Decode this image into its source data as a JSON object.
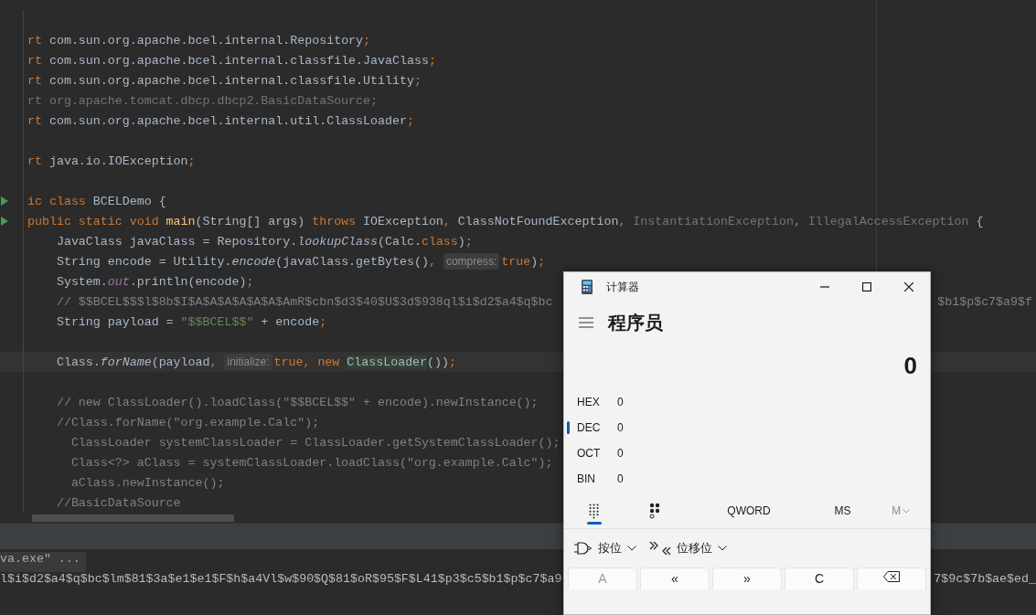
{
  "editor": {
    "lines": [
      {
        "kind": "line",
        "run": false
      },
      {
        "kind": "line",
        "run": false,
        "tokens": [
          {
            "kind": "keyword",
            "text": "rt"
          },
          {
            "kind": "plain",
            "text": " com.sun.org.apache.bcel.internal.Repository"
          },
          {
            "kind": "keyword",
            "text": ";"
          }
        ]
      },
      {
        "kind": "line",
        "run": false,
        "tokens": [
          {
            "kind": "keyword",
            "text": "rt"
          },
          {
            "kind": "plain",
            "text": " com.sun.org.apache.bcel.internal.classfile.JavaClass"
          },
          {
            "kind": "keyword",
            "text": ";"
          }
        ]
      },
      {
        "kind": "line",
        "run": false,
        "tokens": [
          {
            "kind": "keyword",
            "text": "rt"
          },
          {
            "kind": "plain",
            "text": " com.sun.org.apache.bcel.internal.classfile.Utility"
          },
          {
            "kind": "keyword",
            "text": ";"
          }
        ]
      },
      {
        "kind": "line",
        "run": false,
        "tokens": [
          {
            "kind": "unused",
            "text": "rt org.apache.tomcat.dbcp.dbcp2.BasicDataSource;"
          }
        ]
      },
      {
        "kind": "line",
        "run": false,
        "tokens": [
          {
            "kind": "keyword",
            "text": "rt"
          },
          {
            "kind": "plain",
            "text": " com.sun.org.apache.bcel.internal.util.ClassLoader"
          },
          {
            "kind": "keyword",
            "text": ";"
          }
        ]
      },
      {
        "kind": "line",
        "run": false
      },
      {
        "kind": "line",
        "run": false,
        "tokens": [
          {
            "kind": "keyword",
            "text": "rt"
          },
          {
            "kind": "plain",
            "text": " java.io.IOException"
          },
          {
            "kind": "keyword",
            "text": ";"
          }
        ]
      },
      {
        "kind": "line",
        "run": false
      },
      {
        "kind": "line",
        "run": true,
        "tokens": [
          {
            "kind": "keyword",
            "text": "ic class"
          },
          {
            "kind": "plain",
            "text": " BCELDemo {"
          }
        ]
      },
      {
        "kind": "line",
        "run": true,
        "tokens": [
          {
            "kind": "keyword",
            "text": "public static void "
          },
          {
            "kind": "method",
            "text": "main"
          },
          {
            "kind": "plain",
            "text": "(String[] args) "
          },
          {
            "kind": "keyword",
            "text": "throws"
          },
          {
            "kind": "plain",
            "text": " IOException"
          },
          {
            "kind": "keyword",
            "text": ","
          },
          {
            "kind": "plain",
            "text": " ClassNotFoundException"
          },
          {
            "kind": "keyword",
            "text": ","
          },
          {
            "kind": "unused",
            "text": " InstantiationException"
          },
          {
            "kind": "keyword",
            "text": ","
          },
          {
            "kind": "unused",
            "text": " IllegalAccessException"
          },
          {
            "kind": "plain",
            "text": " {"
          }
        ]
      },
      {
        "kind": "line",
        "run": false,
        "tokens": [
          {
            "kind": "plain",
            "text": "    JavaClass javaClass = Repository."
          },
          {
            "kind": "static",
            "text": "lookupClass"
          },
          {
            "kind": "plain",
            "text": "(Calc."
          },
          {
            "kind": "keyword",
            "text": "class"
          },
          {
            "kind": "plain",
            "text": ")"
          },
          {
            "kind": "keyword",
            "text": ";"
          }
        ]
      },
      {
        "kind": "line",
        "run": false,
        "tokens": [
          {
            "kind": "plain",
            "text": "    String encode = Utility."
          },
          {
            "kind": "static",
            "text": "encode"
          },
          {
            "kind": "plain",
            "text": "(javaClass.getBytes()"
          },
          {
            "kind": "keyword",
            "text": ", "
          },
          {
            "kind": "hint",
            "text": "compress:"
          },
          {
            "kind": "keyword",
            "text": "true"
          },
          {
            "kind": "plain",
            "text": ")"
          },
          {
            "kind": "keyword",
            "text": ";"
          }
        ]
      },
      {
        "kind": "line",
        "run": false,
        "tokens": [
          {
            "kind": "plain",
            "text": "    System."
          },
          {
            "kind": "field",
            "text": "out"
          },
          {
            "kind": "plain",
            "text": ".println(encode)"
          },
          {
            "kind": "keyword",
            "text": ";"
          }
        ]
      },
      {
        "kind": "line",
        "run": false,
        "tokens": [
          {
            "kind": "comment",
            "text": "    // $$BCEL$$$l$8b$I$A$A$A$A$A$A$AmR$cbn$d3$40$U$3d$938ql$i$d2$a4$q$bc"
          }
        ],
        "tail": [
          {
            "kind": "comment",
            "text": "$b1$p$c7$a9$f"
          }
        ]
      },
      {
        "kind": "line",
        "run": false,
        "tokens": [
          {
            "kind": "plain",
            "text": "    String payload = "
          },
          {
            "kind": "string",
            "text": "\"$$BCEL$$\""
          },
          {
            "kind": "plain",
            "text": " + encode"
          },
          {
            "kind": "keyword",
            "text": ";"
          }
        ]
      },
      {
        "kind": "line",
        "run": false
      },
      {
        "kind": "caret_line",
        "run": false,
        "tokens": [
          {
            "kind": "plain",
            "text": "    Class."
          },
          {
            "kind": "static",
            "text": "forName"
          },
          {
            "kind": "plain",
            "text": "(payload"
          },
          {
            "kind": "keyword",
            "text": ", "
          },
          {
            "kind": "hint",
            "text": "initialize:"
          },
          {
            "kind": "keyword",
            "text": "true, new "
          },
          {
            "kind": "usage",
            "text": "ClassLoader"
          },
          {
            "kind": "plain",
            "text": "())"
          },
          {
            "kind": "keyword",
            "text": ";"
          }
        ]
      },
      {
        "kind": "line",
        "run": false
      },
      {
        "kind": "line",
        "run": false,
        "tokens": [
          {
            "kind": "comment",
            "text": "    // new ClassLoader().loadClass(\"$$BCEL$$\" + encode).newInstance();"
          }
        ]
      },
      {
        "kind": "line",
        "run": false,
        "tokens": [
          {
            "kind": "comment",
            "text": "    //Class.forName(\"org.example.Calc\");"
          }
        ]
      },
      {
        "kind": "line",
        "run": false,
        "tokens": [
          {
            "kind": "comment",
            "text": "      ClassLoader systemClassLoader = ClassLoader.getSystemClassLoader();"
          }
        ]
      },
      {
        "kind": "line",
        "run": false,
        "tokens": [
          {
            "kind": "comment",
            "text": "      Class<?> aClass = systemClassLoader.loadClass(\"org.example.Calc\");"
          }
        ]
      },
      {
        "kind": "line",
        "run": false,
        "tokens": [
          {
            "kind": "comment",
            "text": "      aClass.newInstance();"
          }
        ]
      },
      {
        "kind": "line",
        "run": false,
        "tokens": [
          {
            "kind": "comment",
            "text": "    //BasicDataSource"
          }
        ]
      }
    ]
  },
  "console": {
    "command": "va.exe\" ...",
    "output": "l$i$d2$a4$q$bc$lm$81$3a$e1$e1$F$h$a4Vl$w$90$Q$81$oR$95$F$L41$p3$c5$b1$p$c7$a9",
    "output_tail": "7$9c$7b$ae$ed_"
  },
  "calculator": {
    "title": "计算器",
    "mode": "程序员",
    "display": "0",
    "radix": [
      {
        "label": "HEX",
        "value": "0",
        "selected": false
      },
      {
        "label": "DEC",
        "value": "0",
        "selected": true
      },
      {
        "label": "OCT",
        "value": "0",
        "selected": false
      },
      {
        "label": "BIN",
        "value": "0",
        "selected": false
      }
    ],
    "keypad_tabs": [
      {
        "kind": "keypad",
        "selected": true
      },
      {
        "kind": "bits",
        "selected": false
      }
    ],
    "word_size": "QWORD",
    "memory": [
      {
        "label": "MS",
        "disabled": false,
        "menu": false
      },
      {
        "label": "M",
        "disabled": true,
        "menu": true
      }
    ],
    "dropdowns": [
      {
        "kind": "bitwise",
        "label": "按位"
      },
      {
        "kind": "shift",
        "label": "位移位"
      }
    ],
    "keys": [
      {
        "kind": "text",
        "label": "A",
        "disabled": true
      },
      {
        "kind": "text",
        "label": "«",
        "disabled": false
      },
      {
        "kind": "text",
        "label": "»",
        "disabled": false
      },
      {
        "kind": "text",
        "label": "C",
        "disabled": false
      },
      {
        "kind": "backspace",
        "disabled": false
      }
    ]
  }
}
